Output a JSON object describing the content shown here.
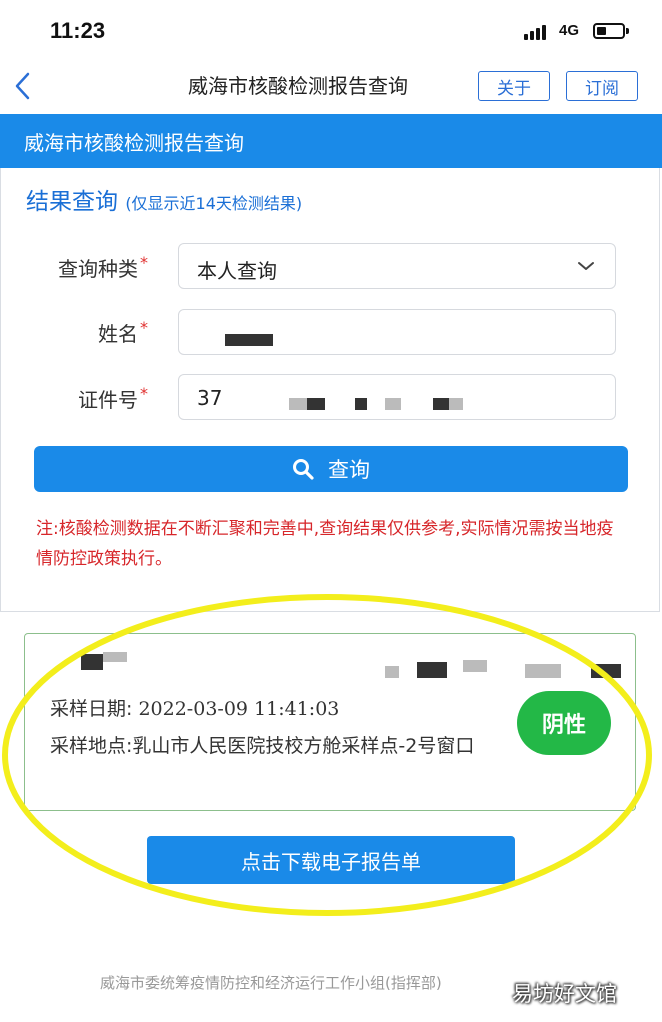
{
  "status_bar": {
    "time": "11:23",
    "network": "4G",
    "battery_level": 0.25
  },
  "nav": {
    "title": "威海市核酸检测报告查询",
    "about_label": "关于",
    "subscribe_label": "订阅"
  },
  "header": {
    "title": "威海市核酸检测报告查询"
  },
  "form": {
    "section_title": "结果查询",
    "section_subtitle": "(仅显示近14天检测结果)",
    "query_type": {
      "label": "查询种类",
      "required_mark": "*",
      "value": "本人查询"
    },
    "name": {
      "label": "姓名",
      "required_mark": "*"
    },
    "id_number": {
      "label": "证件号",
      "required_mark": "*",
      "value": "37"
    },
    "query_button": "查询"
  },
  "note": "注:核酸检测数据在不断汇聚和完善中,查询结果仅供参考,实际情况需按当地疫情防控政策执行。",
  "result": {
    "date_label": "采样日期:",
    "date_value": "2022-03-09 11:41:03",
    "place_label": "采样地点:",
    "place_value": "乳山市人民医院技校方舱采样点-2号窗口",
    "status": "阴性"
  },
  "download_button": "点击下载电子报告单",
  "footer": "威海市委统筹疫情防控和经济运行工作小组(指挥部)",
  "watermark": "易坊好文馆",
  "colors": {
    "primary": "#1a8ae8",
    "required": "#e0302f",
    "negative": "#23b847",
    "highlight": "#f3ee1c"
  }
}
